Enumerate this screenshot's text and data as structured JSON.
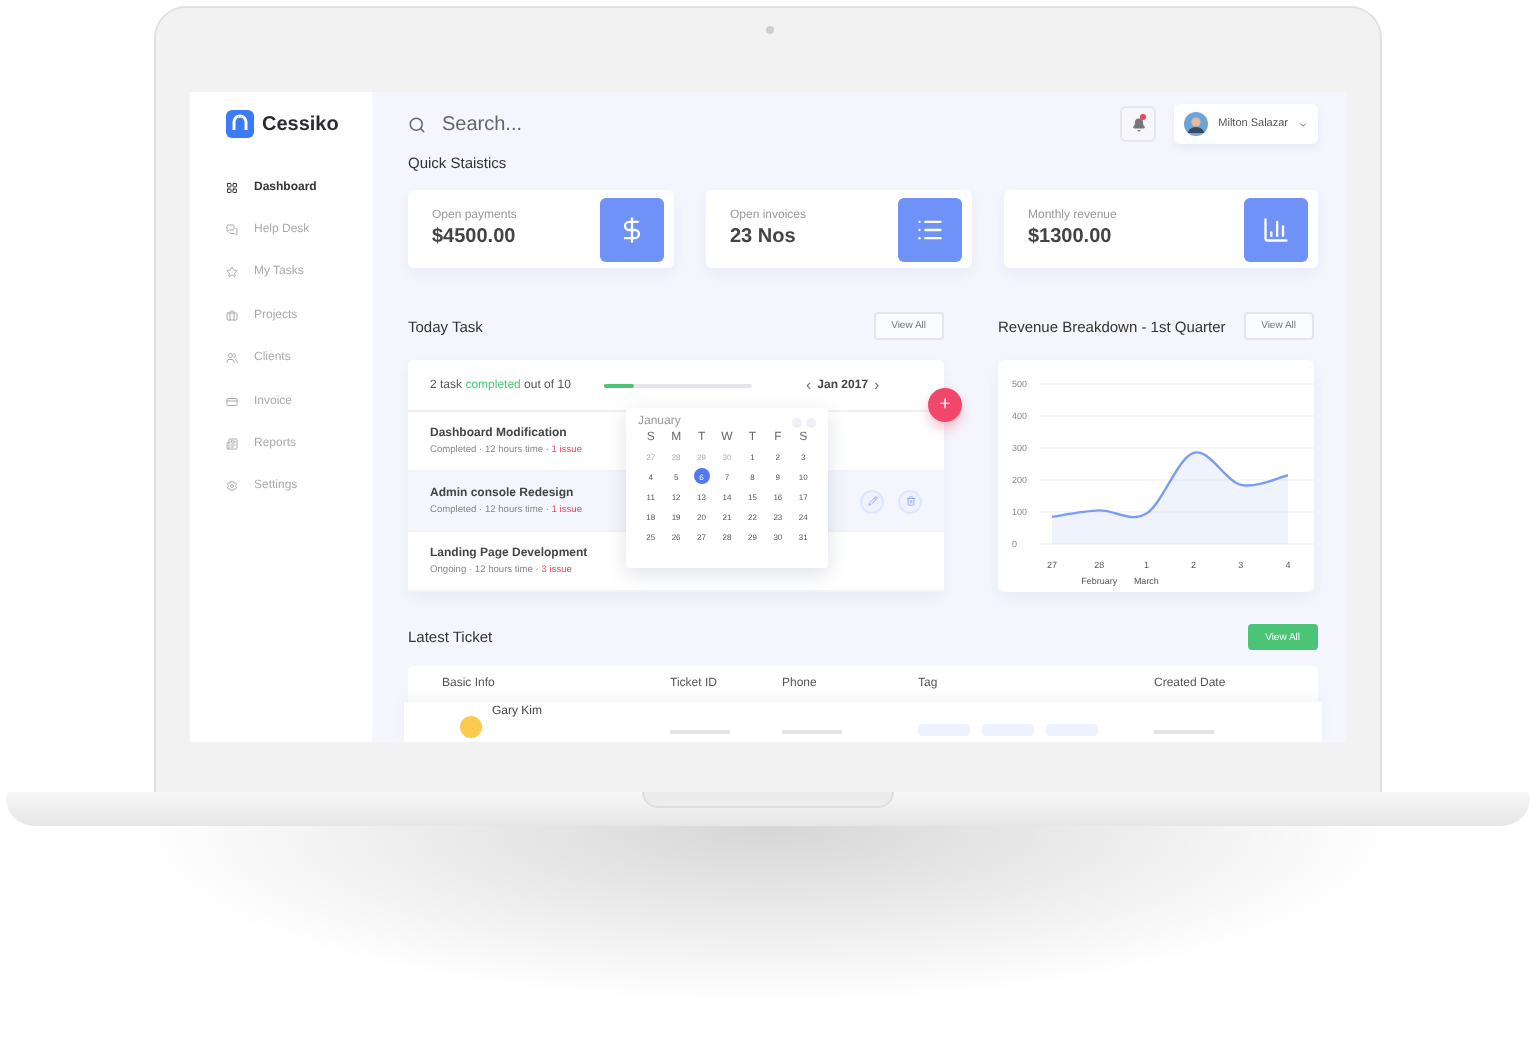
{
  "brand": {
    "name": "Cessiko"
  },
  "sidebar": {
    "items": [
      {
        "label": "Dashboard",
        "selected": true
      },
      {
        "label": "Help Desk",
        "selected": false
      },
      {
        "label": "My Tasks",
        "selected": false
      },
      {
        "label": "Projects",
        "selected": false
      },
      {
        "label": "Clients",
        "selected": false
      },
      {
        "label": "Invoice",
        "selected": false
      },
      {
        "label": "Reports",
        "selected": false
      },
      {
        "label": "Settings",
        "selected": false
      }
    ]
  },
  "search": {
    "placeholder": "Search..."
  },
  "header": {
    "notification": true,
    "user": "Milton Salazar"
  },
  "quick_statistics": {
    "title": "Quick Staistics",
    "cards": [
      {
        "label": "Open payments",
        "value": "$4500.00"
      },
      {
        "label": "Open invoices",
        "value": "23 Nos"
      },
      {
        "label": "Monthly revenue",
        "value": "$1300.00"
      }
    ]
  },
  "today_task": {
    "title": "Today Task",
    "view_all": "View All",
    "summary": {
      "prefix": "2 task",
      "highlight": "completed",
      "suffix": "out of 10"
    },
    "progress": {
      "level": 0.2
    },
    "month": "Jan 2017",
    "prev": "‹",
    "next": "›",
    "add": "+",
    "tasks": [
      {
        "title": "Dashboard Modification",
        "meta": "Completed · 12 hours time ·",
        "issues": "1 issue",
        "selected": false
      },
      {
        "title": "Admin console Redesign",
        "meta": "Completed · 12 hours time ·",
        "issues": "1 issue",
        "selected": true
      },
      {
        "title": "Landing Page Development",
        "meta": "Ongoing · 12 hours time ·",
        "issues": "3 issue",
        "selected": false
      }
    ],
    "calendar": {
      "month": "January",
      "weekdays": [
        "S",
        "M",
        "T",
        "W",
        "T",
        "F",
        "S"
      ],
      "days": [
        {
          "label": "27",
          "outside": true,
          "selected": false
        },
        {
          "label": "28",
          "outside": true,
          "selected": false
        },
        {
          "label": "29",
          "outside": true,
          "selected": false
        },
        {
          "label": "30",
          "outside": true,
          "selected": false
        },
        {
          "label": "1",
          "outside": false,
          "selected": false
        },
        {
          "label": "2",
          "outside": false,
          "selected": false
        },
        {
          "label": "3",
          "outside": false,
          "selected": false
        },
        {
          "label": "4",
          "outside": false,
          "selected": false
        },
        {
          "label": "5",
          "outside": false,
          "selected": false
        },
        {
          "label": "6",
          "outside": false,
          "selected": true
        },
        {
          "label": "7",
          "outside": false,
          "selected": false
        },
        {
          "label": "8",
          "outside": false,
          "selected": false
        },
        {
          "label": "9",
          "outside": false,
          "selected": false
        },
        {
          "label": "10",
          "outside": false,
          "selected": false
        },
        {
          "label": "11",
          "outside": false,
          "selected": false
        },
        {
          "label": "12",
          "outside": false,
          "selected": false
        },
        {
          "label": "13",
          "outside": false,
          "selected": false
        },
        {
          "label": "14",
          "outside": false,
          "selected": false
        },
        {
          "label": "15",
          "outside": false,
          "selected": false
        },
        {
          "label": "16",
          "outside": false,
          "selected": false
        },
        {
          "label": "17",
          "outside": false,
          "selected": false
        },
        {
          "label": "18",
          "outside": false,
          "selected": false
        },
        {
          "label": "19",
          "outside": false,
          "selected": false
        },
        {
          "label": "20",
          "outside": false,
          "selected": false
        },
        {
          "label": "21",
          "outside": false,
          "selected": false
        },
        {
          "label": "22",
          "outside": false,
          "selected": false
        },
        {
          "label": "23",
          "outside": false,
          "selected": false
        },
        {
          "label": "24",
          "outside": false,
          "selected": false
        },
        {
          "label": "25",
          "outside": false,
          "selected": false
        },
        {
          "label": "26",
          "outside": false,
          "selected": false
        },
        {
          "label": "27",
          "outside": false,
          "selected": false
        },
        {
          "label": "28",
          "outside": false,
          "selected": false
        },
        {
          "label": "29",
          "outside": false,
          "selected": false
        },
        {
          "label": "30",
          "outside": false,
          "selected": false
        },
        {
          "label": "31",
          "outside": false,
          "selected": false
        }
      ]
    }
  },
  "revenue": {
    "title": "Revenue Breakdown - 1st Quarter",
    "view_all": "View All",
    "months": [
      "February",
      "March"
    ],
    "chart_data": {
      "type": "area",
      "categories": [
        "27",
        "28",
        "1",
        "2",
        "3",
        "4"
      ],
      "series": [
        {
          "color": "#7b9cf5",
          "values": [
            85,
            105,
            95,
            285,
            185,
            215
          ]
        }
      ],
      "ylim": [
        0,
        500
      ],
      "yticks": [
        0,
        100,
        200,
        300,
        400,
        500
      ],
      "grid": true
    }
  },
  "latest_ticket": {
    "title": "Latest Ticket",
    "view_all": "View All",
    "columns": [
      "Basic Info",
      "Ticket ID",
      "Phone",
      "Tag",
      "Created Date"
    ],
    "rows": [
      {
        "name": "Gary Kim"
      }
    ]
  }
}
